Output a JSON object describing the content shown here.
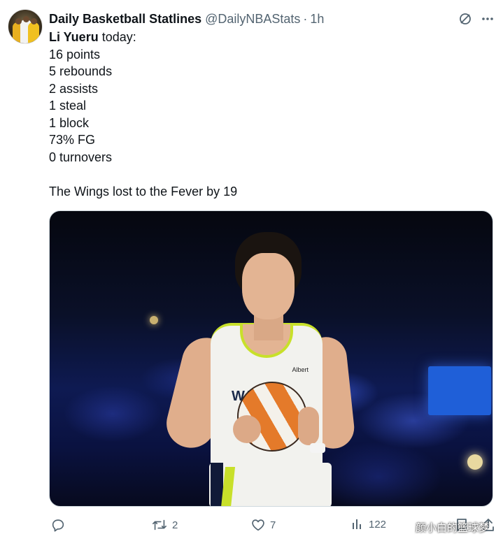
{
  "tweet": {
    "display_name": "Daily Basketball Statlines",
    "handle": "@DailyNBAStats",
    "separator": "·",
    "time": "1h",
    "mention": "Li Yueru",
    "first_line_rest": " today:",
    "stats": [
      "16 points",
      "5 rebounds",
      "2 assists",
      "1 steal",
      "1 block",
      "73% FG",
      "0 turnovers"
    ],
    "summary": "The Wings lost to the Fever by 19",
    "jersey_mark": "Albert",
    "jersey_lettering": "WINGS"
  },
  "actions": {
    "replies": "",
    "retweets": "2",
    "likes": "7",
    "views": "122"
  },
  "icons": {
    "header": [
      "grok-icon",
      "more-icon"
    ],
    "actions": [
      "reply-icon",
      "retweet-icon",
      "like-icon",
      "views-icon",
      "bookmark-icon",
      "share-icon"
    ]
  },
  "watermark": "颜小白的篮球梦",
  "colors": {
    "text": "#0f1419",
    "secondary": "#536471",
    "jersey_accent": "#c8e02a"
  }
}
